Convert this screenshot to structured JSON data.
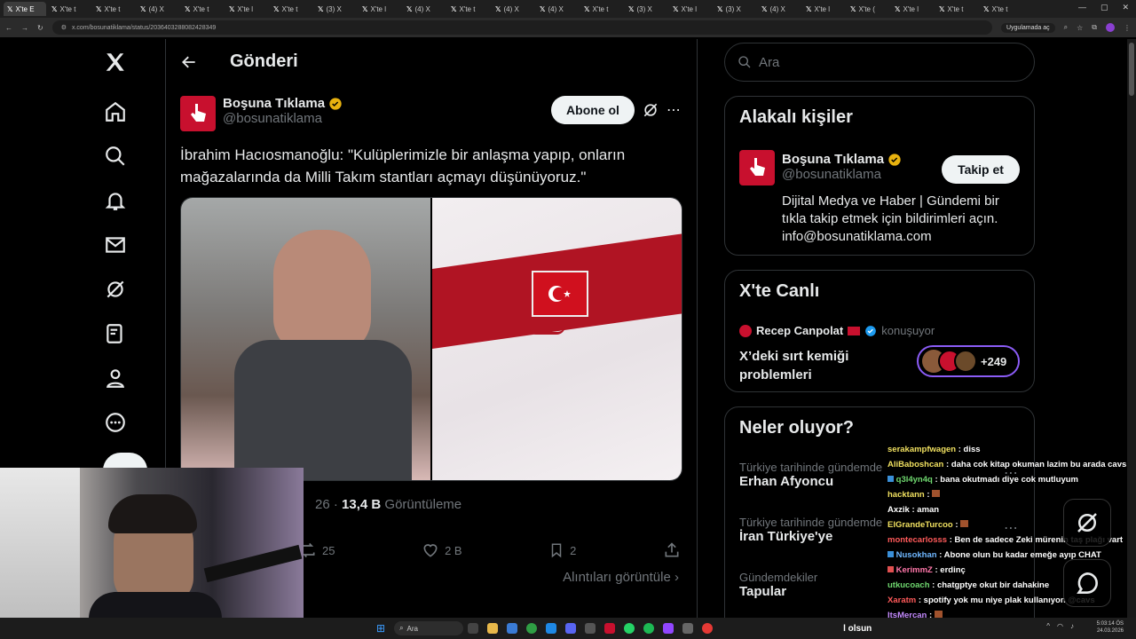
{
  "browser": {
    "tabs": [
      {
        "label": "X'te E",
        "active": true
      },
      {
        "label": "X'te t"
      },
      {
        "label": "X'te t"
      },
      {
        "label": "(4) X"
      },
      {
        "label": "X'te t"
      },
      {
        "label": "X'te l"
      },
      {
        "label": "X'te t"
      },
      {
        "label": "(3) X"
      },
      {
        "label": "X'te l"
      },
      {
        "label": "(4) X"
      },
      {
        "label": "X'te t"
      },
      {
        "label": "(4) X"
      },
      {
        "label": "(4) X"
      },
      {
        "label": "X'te t"
      },
      {
        "label": "(3) X"
      },
      {
        "label": "X'te l"
      },
      {
        "label": "(3) X"
      },
      {
        "label": "(4) X"
      },
      {
        "label": "X'te l"
      },
      {
        "label": "X'te ("
      },
      {
        "label": "X'te l"
      },
      {
        "label": "X'te t"
      },
      {
        "label": "X'te t"
      }
    ],
    "url": "x.com/bosunatiklama/status/2036403288082428349",
    "open_app_label": "Uygulamada aç"
  },
  "header": {
    "title": "Gönderi"
  },
  "tweet": {
    "author_name": "Boşuna Tıklama",
    "handle": "@bosunatiklama",
    "subscribe_label": "Abone ol",
    "text": "İbrahim Hacıosmanoğlu: \"Kulüplerimizle bir anlaşma yapıp, onların mağazalarında da Milli Takım stantları açmayı düşünüyoruz.\"",
    "time_fragment": "26",
    "views_count": "13,4 B",
    "views_label": "Görüntüleme",
    "retweets": "25",
    "likes": "2 B",
    "bookmarks": "2",
    "quotes_link": "Alıntıları görüntüle"
  },
  "right": {
    "search_placeholder": "Ara",
    "related": {
      "title": "Alakalı kişiler",
      "name": "Boşuna Tıklama",
      "handle": "@bosunatiklama",
      "follow_label": "Takip et",
      "bio_line1": "Dijital Medya ve Haber | Gündemi bir",
      "bio_line2": "tıkla takip etmek için bildirimleri açın.",
      "bio_line3": "info@bosunatiklama.com"
    },
    "live": {
      "title": "X'te Canlı",
      "host": "Recep Canpolat",
      "status": "konuşuyor",
      "topic_line1": "X’deki sırt kemiği",
      "topic_line2": "problemleri",
      "listener_count": "+249"
    },
    "trends": {
      "title": "Neler oluyor?",
      "items": [
        {
          "meta": "Türkiye tarihinde gündemde",
          "name": "Erhan Afyoncu"
        },
        {
          "meta": "Türkiye tarihinde gündemde",
          "name": "İran Türkiye'ye"
        },
        {
          "meta": "Gündemdekiler",
          "name": "Tapular"
        }
      ]
    }
  },
  "chat": [
    {
      "user": "serakampfwagen",
      "color": "#f0e060",
      "msg": "diss"
    },
    {
      "user": "AliBaboshcan",
      "color": "#f0e060",
      "msg": "daha cok kitap okuman lazim bu arada cavs"
    },
    {
      "user": "q3l4yn4q",
      "color": "#6fd86f",
      "msg": "bana okutmadı diye cok mutluyum"
    },
    {
      "user": "hacktann",
      "color": "#f0e060",
      "msg": ""
    },
    {
      "user": "Axzik",
      "color": "#ffffff",
      "msg": "aman"
    },
    {
      "user": "ElGrandeTurcoo",
      "color": "#f0e060",
      "msg": ""
    },
    {
      "user": "montecarlosss",
      "color": "#ff5a5a",
      "msg": "Ben de sadece Zeki mürenin taş plağı vart"
    },
    {
      "user": "Nusokhan",
      "color": "#6fb7ff",
      "msg": "Abone olun bu kadar emeğe ayıp CHAT"
    },
    {
      "user": "KerimmZ",
      "color": "#ff77aa",
      "msg": "erdinç"
    },
    {
      "user": "utkucoach",
      "color": "#6fd86f",
      "msg": "chatgptye okut bir dahakine"
    },
    {
      "user": "Xaratm",
      "color": "#ff5a5a",
      "msg": "spotify yok mu niye plak kullanıyon @cavs"
    },
    {
      "user": "ItsMercan",
      "color": "#c58cff",
      "msg": ""
    }
  ],
  "taskbar": {
    "search_label": "Ara",
    "media_text": "l olsun",
    "time": "5:03:14 ÖS",
    "date": "24.03.2026"
  },
  "colors": {
    "accent_verified": "#e8b20f",
    "brand_red": "#c8102e",
    "x_blue": "#1d9bf0"
  }
}
